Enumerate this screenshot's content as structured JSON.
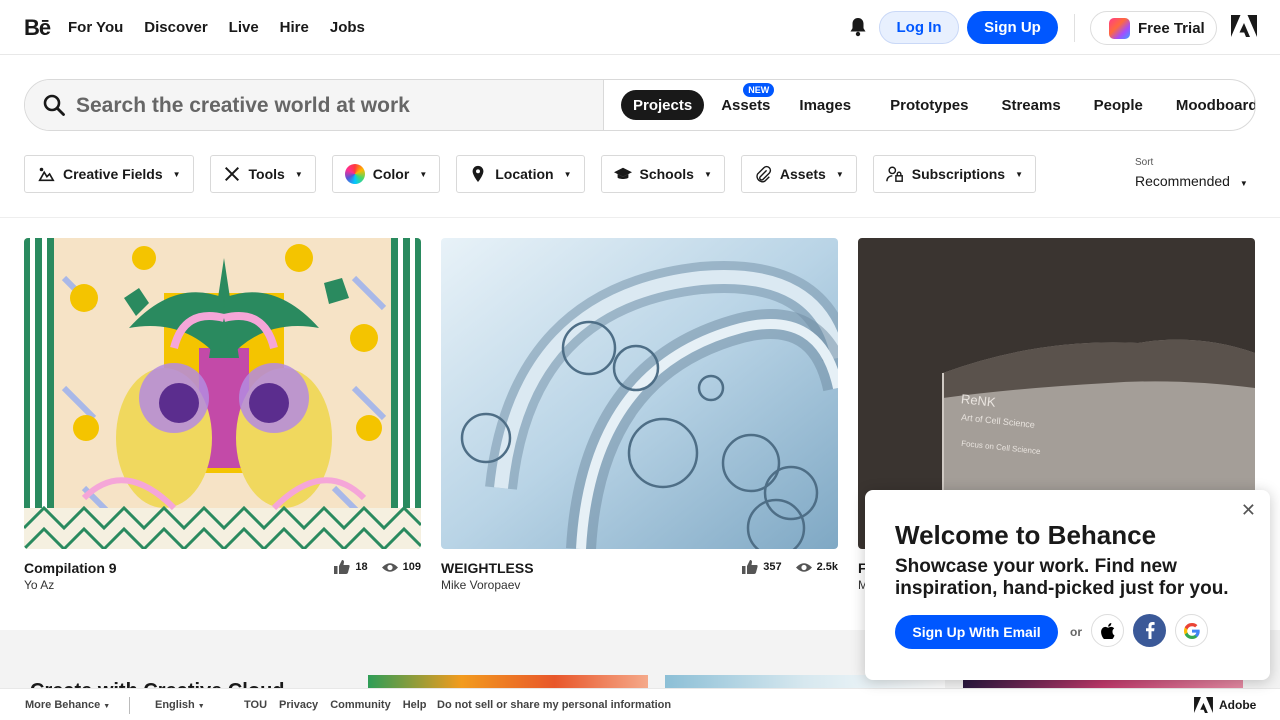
{
  "nav": {
    "logo": "Bē",
    "links": [
      "For You",
      "Discover",
      "Live",
      "Hire",
      "Jobs"
    ],
    "login_label": "Log In",
    "signup_label": "Sign Up",
    "trial_label": "Free Trial"
  },
  "search": {
    "placeholder": "Search the creative world at work",
    "tabs": [
      "Projects",
      "Assets",
      "Images",
      "Prototypes",
      "Streams",
      "People",
      "Moodboards"
    ],
    "active_tab": "Projects",
    "new_badge": "NEW"
  },
  "filters": [
    "Creative Fields",
    "Tools",
    "Color",
    "Location",
    "Schools",
    "Assets",
    "Subscriptions"
  ],
  "sort": {
    "label": "Sort",
    "value": "Recommended"
  },
  "projects": [
    {
      "title": "Compilation 9",
      "owner": "Yo Az",
      "likes": "18",
      "views": "109"
    },
    {
      "title": "WEIGHTLESS",
      "owner": "Mike Voropaev",
      "likes": "357",
      "views": "2.5k"
    },
    {
      "title": "F",
      "owner": "M"
    }
  ],
  "project3_label": {
    "brand": "ReNK",
    "line1": "Art of Cell Science",
    "line2": "Focus on Cell Science"
  },
  "bottom": {
    "heading": "Create with Creative Cloud"
  },
  "footer": {
    "more": "More Behance",
    "language": "English",
    "links": [
      "TOU",
      "Privacy",
      "Community",
      "Help"
    ],
    "dns": "Do not sell or share my personal information",
    "adobe": "Adobe"
  },
  "modal": {
    "title": "Welcome to Behance",
    "subtitle": "Showcase your work. Find new inspiration, hand-picked just for you.",
    "email_button": "Sign Up With Email",
    "or": "or"
  },
  "colors": {
    "accent": "#0057ff",
    "dark": "#191919",
    "facebook": "#3b5998"
  }
}
